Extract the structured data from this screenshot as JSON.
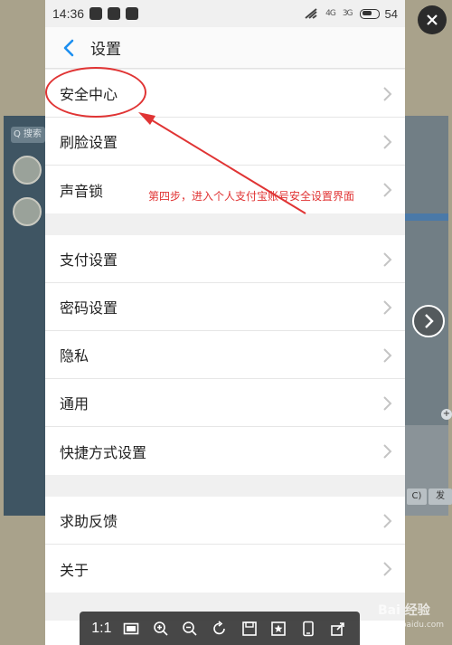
{
  "status_bar": {
    "time": "14:36",
    "battery": "54",
    "signal_1": "4G",
    "signal_2": "3G"
  },
  "header": {
    "title": "设置"
  },
  "groups": [
    {
      "items": [
        {
          "label": "安全中心"
        },
        {
          "label": "刷脸设置"
        },
        {
          "label": "声音锁"
        }
      ]
    },
    {
      "items": [
        {
          "label": "支付设置"
        },
        {
          "label": "密码设置"
        },
        {
          "label": "隐私"
        },
        {
          "label": "通用"
        },
        {
          "label": "快捷方式设置"
        }
      ]
    },
    {
      "items": [
        {
          "label": "求助反馈"
        },
        {
          "label": "关于"
        }
      ]
    }
  ],
  "annotation": {
    "text": "第四步，进入个人支付宝账号安全设置界面",
    "color": "#e03434"
  },
  "background": {
    "search_placeholder": "Q 搜索"
  },
  "viewer": {
    "zoom_label": "1:1",
    "background_send": "发",
    "background_c": "C)"
  },
  "watermark": {
    "text": "Bai 经验",
    "sub": "jingyan.baidu.com"
  },
  "colors": {
    "accent_blue": "#1c8ff0",
    "annotation_red": "#e03434"
  },
  "icons": [
    "back-chevron-icon",
    "chevron-right-icon",
    "close-icon",
    "next-arrow-icon",
    "fit-screen-icon",
    "zoom-in-icon",
    "zoom-out-icon",
    "rotate-icon",
    "save-icon",
    "favorite-icon",
    "phone-icon",
    "share-icon"
  ]
}
